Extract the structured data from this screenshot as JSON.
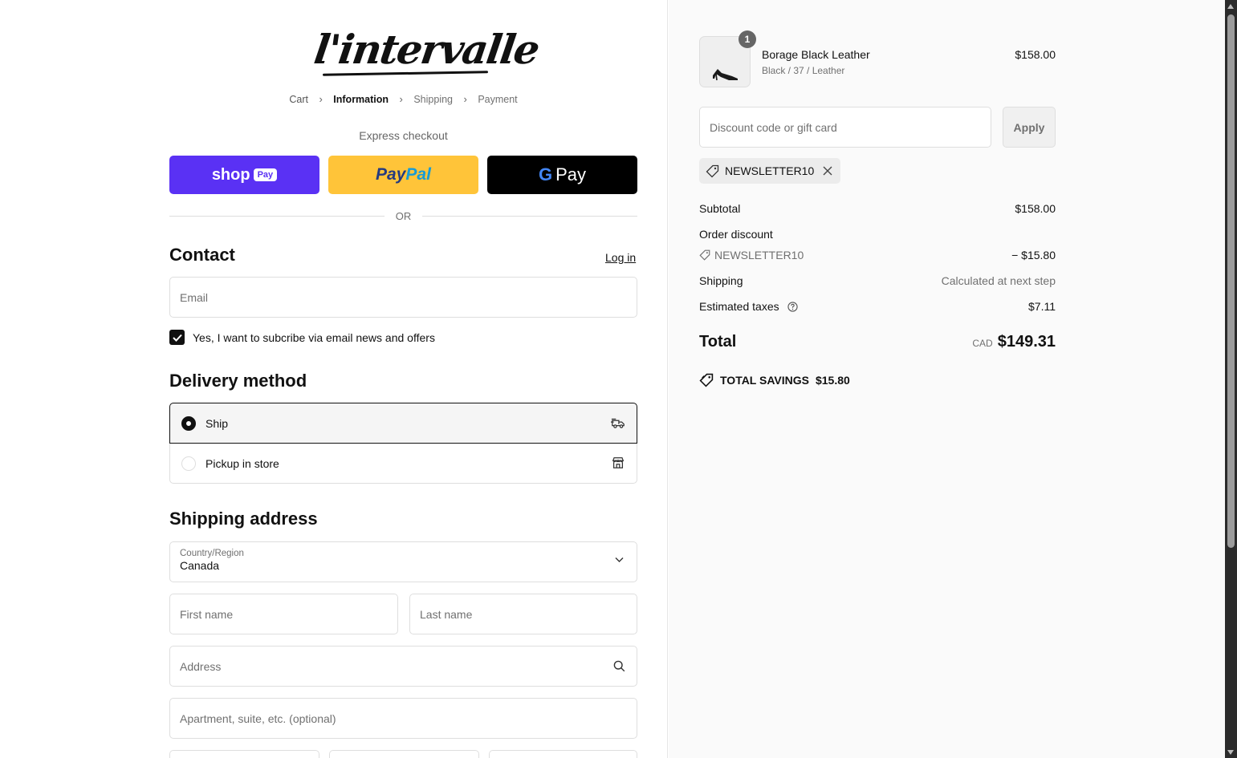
{
  "brand": {
    "logo_text": "l'intervalle"
  },
  "breadcrumb": [
    {
      "label": "Cart"
    },
    {
      "label": "Information"
    },
    {
      "label": "Shipping"
    },
    {
      "label": "Payment"
    }
  ],
  "express": {
    "label": "Express checkout",
    "shop_pay_main": "shop",
    "shop_pay_pill": "Pay",
    "paypal_a": "Pay",
    "paypal_b": "Pal",
    "gpay_g": "G",
    "gpay_text": "Pay",
    "or_text": "OR"
  },
  "contact": {
    "title": "Contact",
    "login_label": "Log in",
    "email_placeholder": "Email",
    "subscribe_label": "Yes, I want to subcribe via email news and offers",
    "subscribe_checked": true
  },
  "delivery": {
    "title": "Delivery method",
    "options": [
      {
        "label": "Ship",
        "selected": true,
        "icon": "truck-icon"
      },
      {
        "label": "Pickup in store",
        "selected": false,
        "icon": "store-icon"
      }
    ]
  },
  "shipping": {
    "title": "Shipping address",
    "country_label": "Country/Region",
    "country_value": "Canada",
    "first_name_placeholder": "First name",
    "last_name_placeholder": "Last name",
    "address_placeholder": "Address",
    "apartment_placeholder": "Apartment, suite, etc. (optional)"
  },
  "order": {
    "product": {
      "name": "Borage Black Leather",
      "variant": "Black / 37 / Leather",
      "price": "$158.00",
      "quantity": "1"
    },
    "discount_placeholder": "Discount code or gift card",
    "apply_label": "Apply",
    "applied_code": "NEWSLETTER10",
    "subtotal_label": "Subtotal",
    "subtotal_value": "$158.00",
    "order_discount_label": "Order discount",
    "order_discount_code": "NEWSLETTER10",
    "order_discount_value": "− $15.80",
    "shipping_label": "Shipping",
    "shipping_value": "Calculated at next step",
    "taxes_label": "Estimated taxes",
    "taxes_value": "$7.11",
    "total_label": "Total",
    "total_currency": "CAD",
    "total_value": "$149.31",
    "savings_label": "TOTAL SAVINGS",
    "savings_value": "$15.80"
  },
  "colors": {
    "shop_pay": "#5a31f4",
    "paypal": "#ffc439",
    "gpay": "#000000",
    "summary_bg": "#fafafa"
  }
}
